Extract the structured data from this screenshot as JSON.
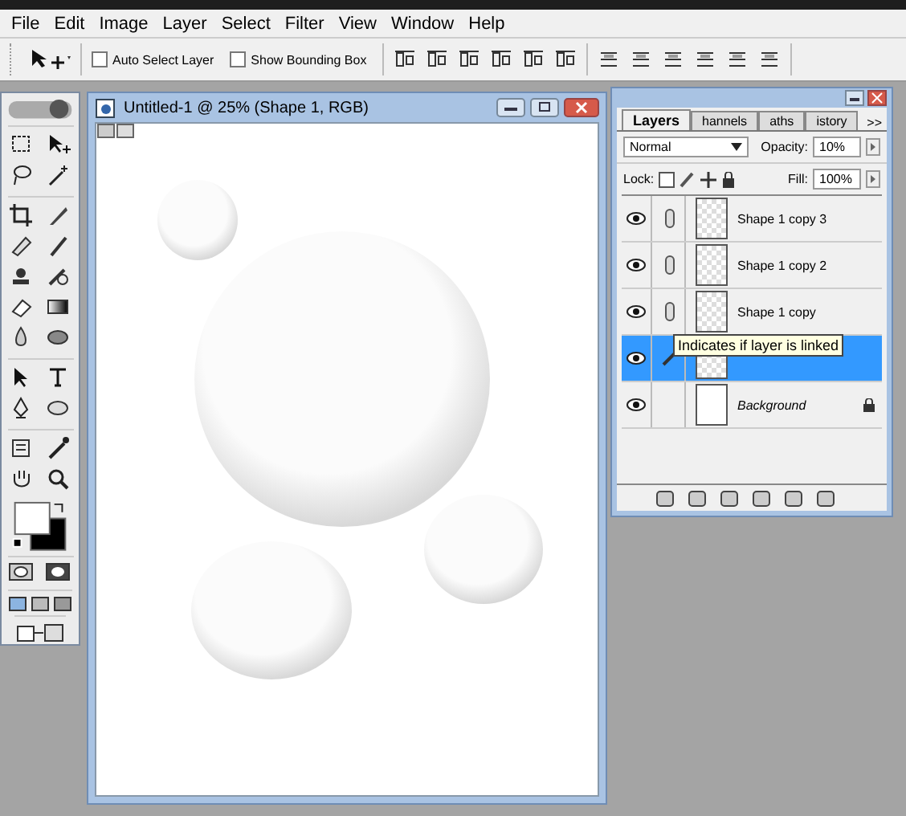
{
  "menu": [
    {
      "label": "File"
    },
    {
      "label": "Edit"
    },
    {
      "label": "Image"
    },
    {
      "label": "Layer"
    },
    {
      "label": "Select"
    },
    {
      "label": "Filter"
    },
    {
      "label": "View"
    },
    {
      "label": "Window"
    },
    {
      "label": "Help"
    }
  ],
  "options_bar": {
    "checkboxes": [
      {
        "label": "Auto Select Layer",
        "checked": false
      },
      {
        "label": "Show Bounding Box",
        "checked": false
      }
    ]
  },
  "document": {
    "title": "Untitled-1 @ 25% (Shape 1, RGB)"
  },
  "layers_panel": {
    "tabs": [
      {
        "label": "Layers",
        "selected": true
      },
      {
        "label": "hannels",
        "selected": false
      },
      {
        "label": "aths",
        "selected": false
      },
      {
        "label": "istory",
        "selected": false
      }
    ],
    "more": ">>",
    "blend_mode": "Normal",
    "opacity_label": "Opacity:",
    "opacity": "10%",
    "lock_label": "Lock:",
    "fill_label": "Fill:",
    "fill": "100%",
    "layers": [
      {
        "kind": "shape",
        "name": "Shape 1 copy 3",
        "visible": true,
        "linked": true,
        "selected": false
      },
      {
        "kind": "shape",
        "name": "Shape 1 copy 2",
        "visible": true,
        "linked": true,
        "selected": false
      },
      {
        "kind": "shape",
        "name": "Shape 1 copy",
        "visible": true,
        "linked": true,
        "selected": false
      },
      {
        "kind": "shape",
        "visible": true,
        "linked": false,
        "selected": true
      },
      {
        "kind": "background",
        "name": "Background",
        "visible": true,
        "linked": false,
        "selected": false,
        "locked": true
      }
    ],
    "tooltip": "Indicates if layer is linked"
  }
}
